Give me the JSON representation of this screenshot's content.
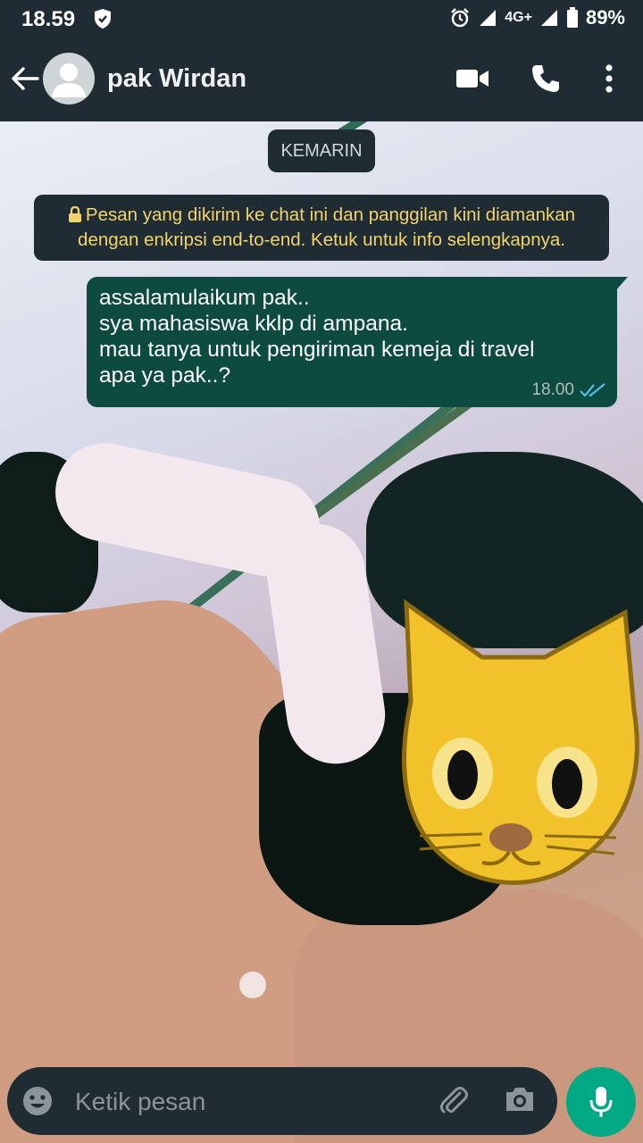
{
  "status_bar": {
    "time": "18.59",
    "network": "4G+",
    "battery": "89%"
  },
  "header": {
    "contact_name": "pak Wirdan",
    "icons": [
      "back-arrow-icon",
      "avatar-icon",
      "video-call-icon",
      "voice-call-icon",
      "more-options-icon"
    ]
  },
  "chat": {
    "date_label": "KEMARIN",
    "encryption_notice": "Pesan yang dikirim ke chat ini dan panggilan kini diamankan dengan enkripsi end-to-end. Ketuk untuk info selengkapnya.",
    "messages": [
      {
        "direction": "outgoing",
        "lines": [
          "assalamulaikum pak..",
          "sya mahasiswa kklp di ampana.",
          "mau tanya untuk pengiriman kemeja di travel",
          "apa ya pak..?"
        ],
        "time": "18.00",
        "status": "read"
      }
    ]
  },
  "composer": {
    "placeholder": "Ketik pesan",
    "icons": [
      "emoji-icon",
      "attach-icon",
      "camera-icon",
      "mic-icon"
    ]
  },
  "colors": {
    "bar_bg": "#1f2c33",
    "bubble_out": "#0d4a40",
    "accent": "#00a884",
    "notice_text": "#f3d36b",
    "read_tick": "#53bdeb"
  }
}
